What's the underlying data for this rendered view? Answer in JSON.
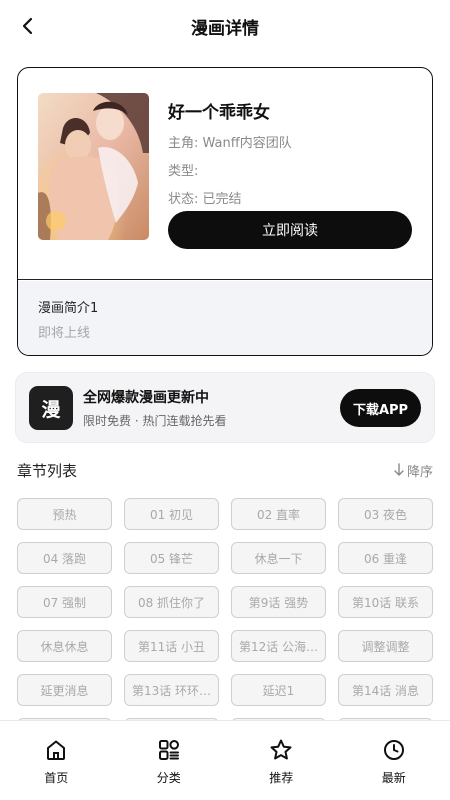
{
  "header": {
    "title": "漫画详情",
    "back_icon": "chevron-left-icon"
  },
  "comic": {
    "title": "好一个乖乖女",
    "protagonist_label": "主角:",
    "protagonist_value": "Wanff内容团队",
    "type_label": "类型:",
    "type_value": "",
    "status_label": "状态:",
    "status_value": "已完结",
    "read_button": "立即阅读",
    "intro_title": "漫画简介1",
    "intro_text": "即将上线"
  },
  "banner": {
    "icon_char": "漫",
    "title": "全网爆款漫画更新中",
    "subtitle": "限时免费 · 热门连载抢先看",
    "button": "下载APP"
  },
  "chapters": {
    "heading": "章节列表",
    "sort_label": "降序",
    "sort_icon": "arrow-down-icon",
    "items": [
      "预热",
      "01 初见",
      "02 直率",
      "03 夜色",
      "04 落跑",
      "05 锋芒",
      "休息一下",
      "06 重逢",
      "07 强制",
      "08 抓住你了",
      "第9话 强势",
      "第10话 联系",
      "休息休息",
      "第11话 小丑",
      "第12话 公海…",
      "调整调整",
      "延更消息",
      "第13话 环环…",
      "延迟1",
      "第14话 消息",
      "",
      "",
      "",
      ""
    ]
  },
  "tabbar": {
    "items": [
      {
        "label": "首页",
        "icon": "home-icon"
      },
      {
        "label": "分类",
        "icon": "category-grid-icon"
      },
      {
        "label": "推荐",
        "icon": "star-icon"
      },
      {
        "label": "最新",
        "icon": "clock-icon"
      }
    ]
  },
  "colors": {
    "primary": "#0d0d0d",
    "chapter_text": "#a9a9a9",
    "intro_bg": "#f3f4f8"
  }
}
